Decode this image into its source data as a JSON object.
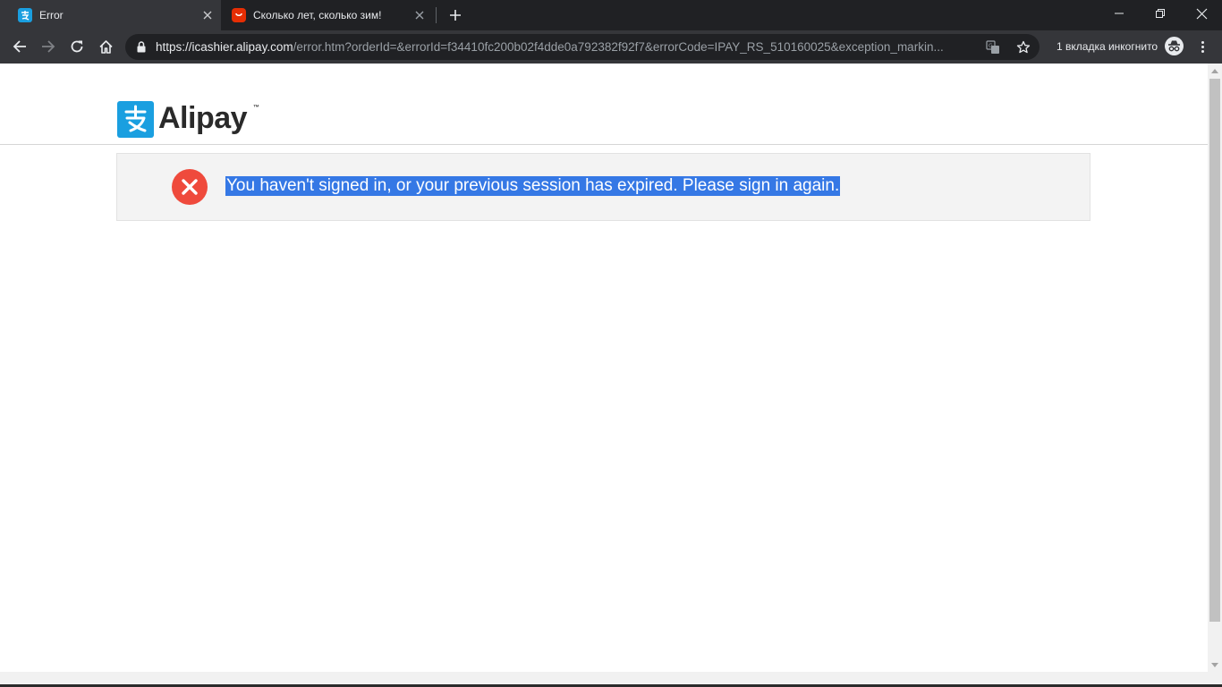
{
  "browser": {
    "tabs": [
      {
        "title": "Error",
        "favicon": "alipay-favicon",
        "active": true
      },
      {
        "title": "Сколько лет, сколько зим!",
        "favicon": "aliexpress-favicon",
        "active": false
      }
    ],
    "address": {
      "host": "https://icashier.alipay.com",
      "path": "/error.htm?orderId=&errorId=f34410fc200b02f4dde0a792382f92f7&errorCode=IPAY_RS_510160025&exception_markin..."
    },
    "incognito_label": "1 вкладка инкогнито",
    "icons": {
      "back": "back-arrow-icon",
      "forward": "forward-arrow-icon",
      "reload": "reload-icon",
      "home": "home-icon",
      "lock": "lock-icon",
      "translate": "translate-icon",
      "bookmark": "star-icon",
      "menu": "kebab-menu-icon"
    }
  },
  "page": {
    "logo": {
      "text": "Alipay",
      "tm": "™",
      "color": "#1a9fe0"
    },
    "error": {
      "message": "You haven't signed in, or your previous session has expired. Please sign in again.",
      "icon": "error-x-icon",
      "icon_color": "#ef4a3c",
      "highlight_color": "#3578e5"
    }
  }
}
